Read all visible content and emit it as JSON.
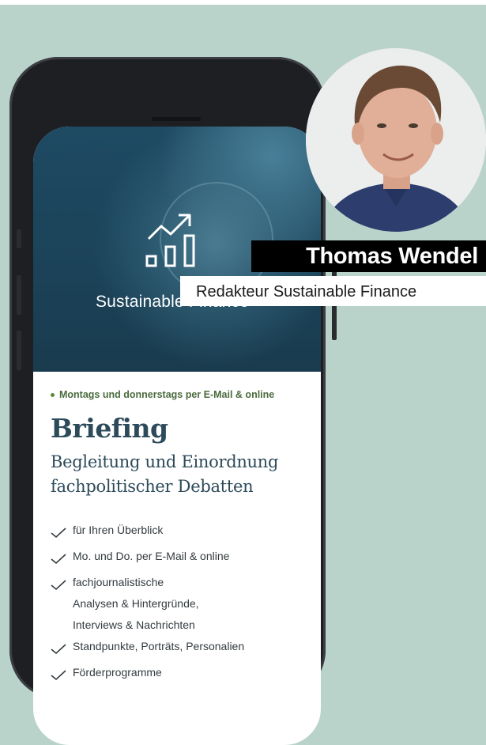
{
  "hero": {
    "title": "Sustainable Finance",
    "icon": "chart-growth-icon"
  },
  "briefing": {
    "frequency": "Montags und donnerstags per E-Mail & online",
    "title": "Briefing",
    "subtitle_line1": "Begleitung und Einordnung",
    "subtitle_line2": "fachpolitischer Debatten",
    "bullets": [
      "für Ihren Überblick",
      "Mo. und Do. per E-Mail & online",
      "fachjournalistische\nAnalysen & Hintergründe,\nInterviews & Nachrichten",
      "Standpunkte, Porträts, Personalien",
      "Förderprogramme"
    ]
  },
  "person": {
    "name": "Thomas Wendel",
    "role": "Redakteur Sustainable Finance"
  },
  "colors": {
    "background": "#b9d3cb",
    "hero": "#1e4a63",
    "heading": "#2d4a5a",
    "accent_green": "#4a6b3d"
  }
}
